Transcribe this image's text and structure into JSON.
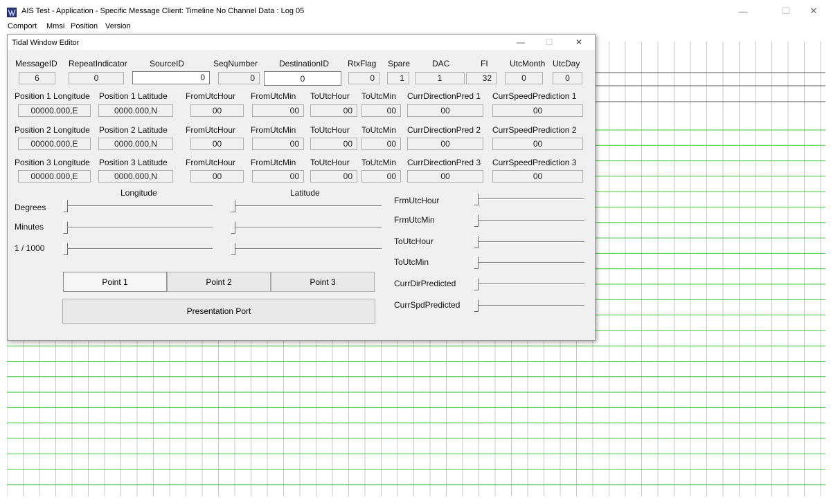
{
  "window": {
    "title": "AIS Test - Application - Specific Message Client: Timeline No Channel Data : Log 05",
    "controls": {
      "minimize": "—",
      "maximize": "☐",
      "close": "✕"
    }
  },
  "menu": [
    "Comport",
    "Mmsi",
    "Position",
    "Version"
  ],
  "dialog": {
    "title": "Tidal Window Editor",
    "controls": {
      "minimize": "—",
      "maximize": "☐",
      "close": "✕"
    },
    "header_labels": [
      "MessageID",
      "RepeatIndicator",
      "SourceID",
      "SeqNumber",
      "DestinationID",
      "RtxFlag",
      "Spare",
      "DAC",
      "FI",
      "UtcMonth",
      "UtcDay"
    ],
    "header_values": [
      "6",
      "0",
      "0",
      "0",
      "0",
      "0",
      "1",
      "1",
      "32",
      "0",
      "0"
    ],
    "positions": [
      {
        "labels": [
          "Position 1 Longitude",
          "Position  1 Latitude",
          "FromUtcHour",
          "FromUtcMin",
          "ToUtcHour",
          "ToUtcMin",
          "CurrDirectionPred 1",
          "CurrSpeedPrediction 1"
        ],
        "values": [
          "00000.000,E",
          "0000.000,N",
          "00",
          "00",
          "00",
          "00",
          "00",
          "00"
        ]
      },
      {
        "labels": [
          "Position 2 Longitude",
          "Position  2 Latitude",
          "FromUtcHour",
          "FromUtcMin",
          "ToUtcHour",
          "ToUtcMin",
          "CurrDirectionPred 2",
          "CurrSpeedPrediction 2"
        ],
        "values": [
          "00000.000,E",
          "0000.000,N",
          "00",
          "00",
          "00",
          "00",
          "00",
          "00"
        ]
      },
      {
        "labels": [
          "Position 3 Longitude",
          "Position  3 Latitude",
          "FromUtcHour",
          "FromUtcMin",
          "ToUtcHour",
          "ToUtcMin",
          "CurrDirectionPred 3",
          "CurrSpeedPrediction 3"
        ],
        "values": [
          "00000.000,E",
          "0000.000,N",
          "00",
          "00",
          "00",
          "00",
          "00",
          "00"
        ]
      }
    ],
    "slider_group": {
      "longitude_label": "Longitude",
      "latitude_label": "Latitude",
      "row_labels": [
        "Degrees",
        "Minutes",
        "1 / 1000"
      ]
    },
    "right_sliders": [
      "FrmUtcHour",
      "FrmUtcMin",
      "ToUtcHour",
      "ToUtcMin",
      "CurrDirPredicted",
      "CurrSpdPredicted"
    ],
    "point_buttons": [
      "Point 1",
      "Point 2",
      "Point 3"
    ],
    "selected_point": "Point 1",
    "presentation_button": "Presentation Port"
  },
  "colors": {
    "grid_green": "#3cc83c",
    "grid_gray": "#c8c8c8",
    "app_icon": "#2a3a78"
  }
}
